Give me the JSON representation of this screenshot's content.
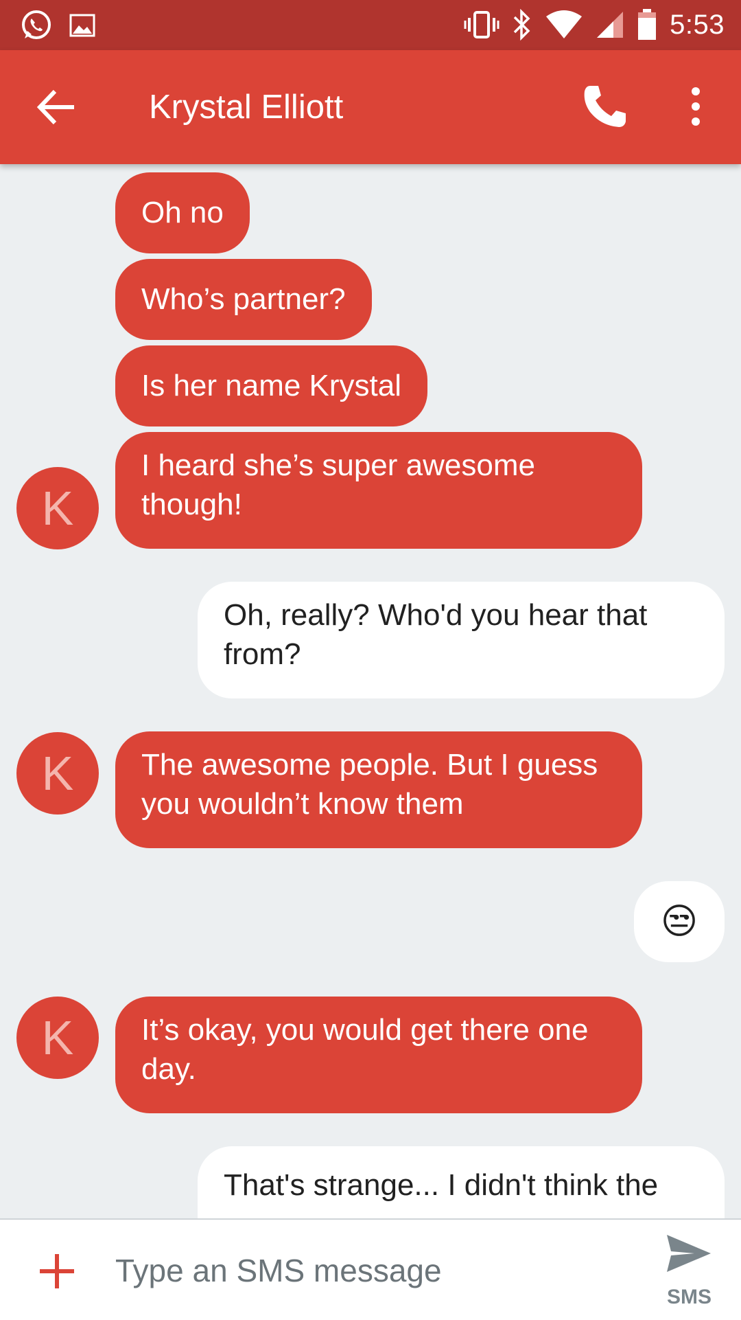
{
  "status_bar": {
    "time": "5:53",
    "left_icons": [
      "whatsapp-icon",
      "image-icon"
    ],
    "right_icons": [
      "vibrate-icon",
      "bluetooth-icon",
      "wifi-icon",
      "cell-signal-icon",
      "battery-icon"
    ]
  },
  "app_bar": {
    "title": "Krystal Elliott",
    "back_icon": "arrow-back-icon",
    "call_icon": "phone-icon",
    "more_icon": "more-vert-icon"
  },
  "contact": {
    "initial": "K",
    "color": "#db4437"
  },
  "messages": [
    {
      "from": "contact",
      "text": "Oh no"
    },
    {
      "from": "contact",
      "text": "Who’s partner?"
    },
    {
      "from": "contact",
      "text": "Is her name Krystal"
    },
    {
      "from": "contact",
      "text": "I heard she’s super awesome though!"
    },
    {
      "from": "me",
      "text": "Oh, really? Who'd you hear that from?"
    },
    {
      "from": "contact",
      "text": "The awesome people. But I guess you wouldn’t know them"
    },
    {
      "from": "me",
      "text": "😒"
    },
    {
      "from": "contact",
      "text": "It’s okay, you would get there one day."
    },
    {
      "from": "me",
      "text": "That's strange... I didn't think the"
    }
  ],
  "composer": {
    "placeholder": "Type an SMS message",
    "send_label": "SMS",
    "attach_icon": "plus-icon",
    "send_icon": "send-icon"
  },
  "colors": {
    "status_bar": "#b0342e",
    "app_bar": "#db4437",
    "background": "#eceff1",
    "incoming_bubble": "#db4437",
    "outgoing_bubble": "#ffffff"
  }
}
